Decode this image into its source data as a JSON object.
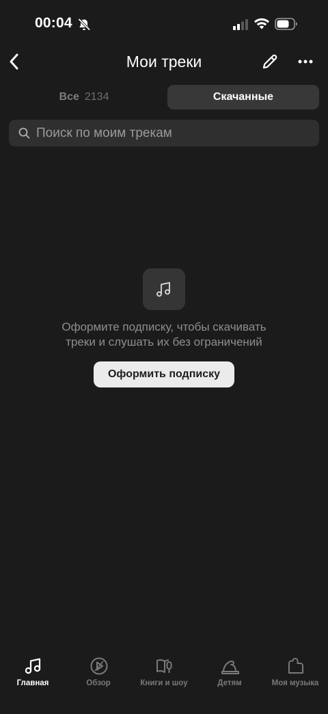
{
  "status_bar": {
    "time": "00:04"
  },
  "header": {
    "title": "Мои треки"
  },
  "tabs": {
    "all_label": "Все",
    "all_count": "2134",
    "downloaded_label": "Скачанные",
    "active": "downloaded"
  },
  "search": {
    "placeholder": "Поиск по моим трекам",
    "value": ""
  },
  "empty_state": {
    "icon": "music-note-icon",
    "line1": "Оформите подписку, чтобы скачивать",
    "line2": "треки и слушать их без ограничений",
    "button_label": "Оформить подписку"
  },
  "bottom_nav": {
    "items": [
      {
        "label": "Главная",
        "icon": "music-note-icon",
        "active": true
      },
      {
        "label": "Обзор",
        "icon": "compass-play-icon",
        "active": false
      },
      {
        "label": "Книги и шоу",
        "icon": "book-mic-icon",
        "active": false
      },
      {
        "label": "Детям",
        "icon": "kids-hat-icon",
        "active": false
      },
      {
        "label": "Моя музыка",
        "icon": "heart-square-icon",
        "active": false
      }
    ]
  },
  "colors": {
    "background": "#1b1b1b",
    "tab_active_bg": "#383838",
    "search_bg": "#2f2f2f",
    "button_bg": "#ebebeb",
    "muted_text": "#8e8e8e"
  }
}
